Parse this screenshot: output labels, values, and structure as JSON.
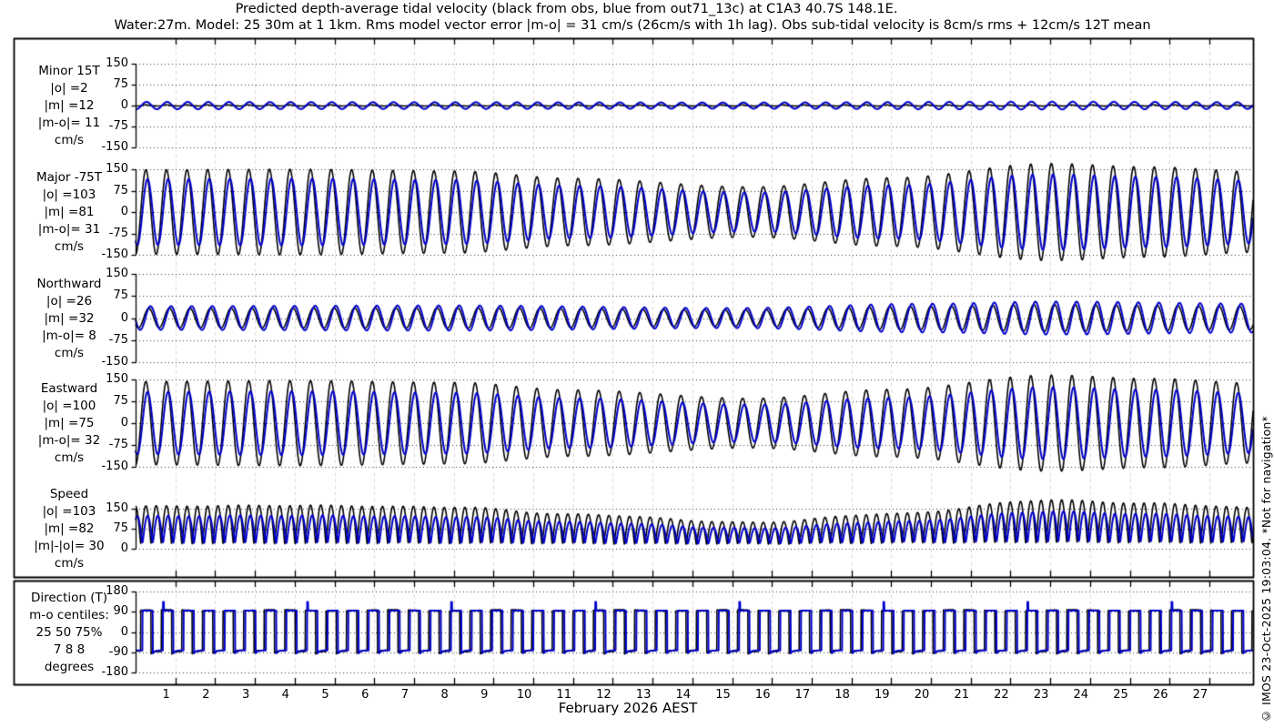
{
  "title": {
    "line1": "Predicted depth-average tidal velocity (black from obs, blue from out71_13c) at C1A3 40.7S 148.1E.",
    "line2": "Water:27m. Model: 25 30m at 1 1km. Rms model vector error |m-o| = 31 cm/s (26cm/s with 1h lag). Obs sub-tidal velocity is 8cm/s rms + 12cm/s 12T mean"
  },
  "watermark": "© IMOS 23-Oct-2025 19:03:04. *Not for navigation*",
  "xaxis": {
    "label": "February 2026 AEST",
    "tick_labels": [
      "1",
      "2",
      "3",
      "4",
      "5",
      "6",
      "7",
      "8",
      "9",
      "10",
      "11",
      "12",
      "13",
      "14",
      "15",
      "16",
      "17",
      "18",
      "19",
      "20",
      "21",
      "22",
      "23",
      "24",
      "25",
      "26",
      "27"
    ],
    "days_shown": 28.1
  },
  "colors": {
    "obs": "#000000",
    "model": "#0000cc",
    "vgrid": "#e3d8d8",
    "hgrid": "#333333",
    "frame": "#000000",
    "background": "#ffffff"
  },
  "chart_data": {
    "type": "line",
    "title": "Predicted depth-average tidal velocity at C1A3 40.7S 148.1E",
    "x_unit": "days of February 2026 (AEST)",
    "x_range_days": [
      0,
      28.1
    ],
    "legend": [
      {
        "name": "observations",
        "color": "#000000"
      },
      {
        "name": "model out71_13c",
        "color": "#0000cc"
      }
    ],
    "tide_period_days": 0.5175,
    "model_lag_days": 0.042,
    "panels": [
      {
        "name": "minor",
        "label_lines": [
          "Minor 15T",
          "|o| =2",
          "|m| =12",
          "|m-o|= 11",
          "cm/s"
        ],
        "units": "cm/s",
        "ylim": [
          -150,
          150
        ],
        "ytick_values": [
          150,
          75,
          0,
          -75,
          -150
        ],
        "ytick_labels": [
          "150",
          "75",
          "0",
          "-75",
          "-150"
        ],
        "kind": "osc",
        "obs": {
          "rms": 2,
          "amp_envelope": [
            [
              0,
              2
            ],
            [
              28.5,
              2
            ]
          ],
          "phase": 3.1416
        },
        "model": {
          "rms": 12,
          "amp_envelope": [
            [
              0,
              13
            ],
            [
              8,
              12
            ],
            [
              15,
              11
            ],
            [
              23,
              14
            ],
            [
              28.5,
              12
            ]
          ],
          "phase": 3.4416
        }
      },
      {
        "name": "major",
        "label_lines": [
          "Major -75T",
          "|o| =103",
          "|m| =81",
          "|m-o|= 31",
          "cm/s"
        ],
        "units": "cm/s",
        "ylim": [
          -150,
          150
        ],
        "ytick_values": [
          150,
          75,
          0,
          -75,
          -150
        ],
        "ytick_labels": [
          "150",
          "75",
          "0",
          "-75",
          "-150"
        ],
        "kind": "osc",
        "obs": {
          "rms": 103,
          "amp_envelope": [
            [
              0,
              148
            ],
            [
              4,
              150
            ],
            [
              8,
              144
            ],
            [
              11,
              118
            ],
            [
              15.5,
              88
            ],
            [
              19,
              120
            ],
            [
              23,
              170
            ],
            [
              25.5,
              158
            ],
            [
              28.5,
              140
            ]
          ],
          "phase": 3.1416
        },
        "model": {
          "rms": 81,
          "scale_of_obs": 0.78,
          "phase": 3.1416
        }
      },
      {
        "name": "northward",
        "label_lines": [
          "Northward",
          "|o| =26",
          "|m| =32",
          "|m-o|= 8",
          "cm/s"
        ],
        "units": "cm/s",
        "ylim": [
          -150,
          150
        ],
        "ytick_values": [
          150,
          75,
          0,
          -75,
          -150
        ],
        "ytick_labels": [
          "150",
          "75",
          "0",
          "-75",
          "-150"
        ],
        "kind": "osc",
        "obs": {
          "rms": 26,
          "amp_envelope": [
            [
              0,
              33
            ],
            [
              8,
              35
            ],
            [
              15,
              28
            ],
            [
              20,
              40
            ],
            [
              23,
              46
            ],
            [
              28.5,
              40
            ]
          ],
          "phase": 2.2416
        },
        "model": {
          "rms": 32,
          "scale_of_obs": 1.22,
          "phase": 2.2416
        }
      },
      {
        "name": "eastward",
        "label_lines": [
          "Eastward",
          "|o| =100",
          "|m| =75",
          "|m-o|= 32",
          "cm/s"
        ],
        "units": "cm/s",
        "ylim": [
          -150,
          150
        ],
        "ytick_values": [
          150,
          75,
          0,
          -75,
          -150
        ],
        "ytick_labels": [
          "150",
          "75",
          "0",
          "-75",
          "-150"
        ],
        "kind": "osc",
        "obs": {
          "rms": 100,
          "amp_envelope": [
            [
              0,
              143
            ],
            [
              4,
              146
            ],
            [
              8,
              140
            ],
            [
              11,
              114
            ],
            [
              15.5,
              85
            ],
            [
              19,
              116
            ],
            [
              23,
              165
            ],
            [
              25.5,
              153
            ],
            [
              28.5,
              136
            ]
          ],
          "phase": 3.1416
        },
        "model": {
          "rms": 75,
          "scale_of_obs": 0.75,
          "phase": 3.1416
        }
      },
      {
        "name": "speed",
        "label_lines": [
          "Speed",
          "|o| =103",
          "|m| =82",
          "|m|-|o|= 30",
          "cm/s"
        ],
        "units": "cm/s",
        "ylim": [
          0,
          150
        ],
        "ytick_values": [
          150,
          75,
          0
        ],
        "ytick_labels": [
          "150",
          "75",
          "0"
        ],
        "kind": "speed",
        "obs": {
          "rms": 103,
          "floor": 9
        },
        "model": {
          "rms": 82,
          "floor": 10,
          "scale_of_obs": 0.78
        }
      },
      {
        "name": "direction",
        "label_lines": [
          "Direction (T)",
          "m-o centiles:",
          "25 50 75%",
          "7 8 8",
          "degrees"
        ],
        "units": "degrees",
        "ylim": [
          -180,
          180
        ],
        "ytick_values": [
          180,
          90,
          0,
          -90,
          -180
        ],
        "ytick_labels": [
          "180",
          "90",
          "0",
          "-90",
          "-180"
        ],
        "kind": "direction",
        "obs": {
          "high_deg": 96,
          "low_deg": -84,
          "spike_low_deg": -175
        },
        "model": {
          "high_deg": 95,
          "low_deg": -82,
          "spike_high_deg": 133
        }
      }
    ],
    "grid": {
      "horizontal": "dotted-black-at-each-ytick",
      "vertical": "dashed-light-at-each-day"
    },
    "layout_hint": "6 stacked time-series panels sharing one x axis; panels 1-5 in upper frame, direction panel in lower frame"
  }
}
